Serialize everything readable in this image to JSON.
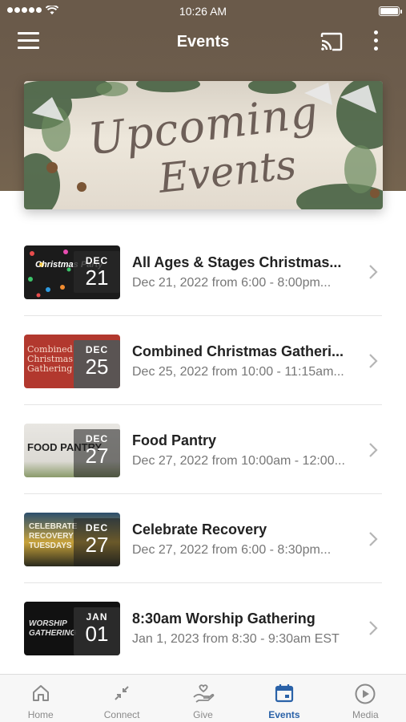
{
  "status_bar": {
    "time": "10:26 AM"
  },
  "header": {
    "title": "Events"
  },
  "banner": {
    "line1": "Upcoming",
    "line2": "Events"
  },
  "events": [
    {
      "title": "All Ages & Stages Christmas...",
      "subtitle": "Dec 21, 2022 from 6:00 - 8:00pm...",
      "month": "DEC",
      "day": "21",
      "art_text": "Christmas Party"
    },
    {
      "title": "Combined Christmas Gatheri...",
      "subtitle": "Dec 25, 2022 from 10:00 - 11:15am...",
      "month": "DEC",
      "day": "25",
      "art_text": "Combined Christmas Gathering"
    },
    {
      "title": "Food Pantry",
      "subtitle": "Dec 27, 2022 from 10:00am - 12:00...",
      "month": "DEC",
      "day": "27",
      "art_text": "FOOD PANTRY"
    },
    {
      "title": "Celebrate Recovery",
      "subtitle": "Dec 27, 2022 from 6:00 - 8:30pm...",
      "month": "DEC",
      "day": "27",
      "art_text": "CELEBRATE RECOVERY TUESDAYS"
    },
    {
      "title": "8:30am Worship Gathering",
      "subtitle": "Jan 1, 2023 from 8:30 - 9:30am EST",
      "month": "JAN",
      "day": "01",
      "art_text": "WORSHIP GATHERING"
    }
  ],
  "tabs": [
    {
      "label": "Home",
      "icon": "home-icon"
    },
    {
      "label": "Connect",
      "icon": "connect-icon"
    },
    {
      "label": "Give",
      "icon": "give-icon"
    },
    {
      "label": "Events",
      "icon": "calendar-icon",
      "active": true
    },
    {
      "label": "Media",
      "icon": "play-icon"
    }
  ],
  "colors": {
    "header": "#6a5a4a",
    "accent": "#2a62a8",
    "inactive_tab": "#8a8a8a"
  }
}
